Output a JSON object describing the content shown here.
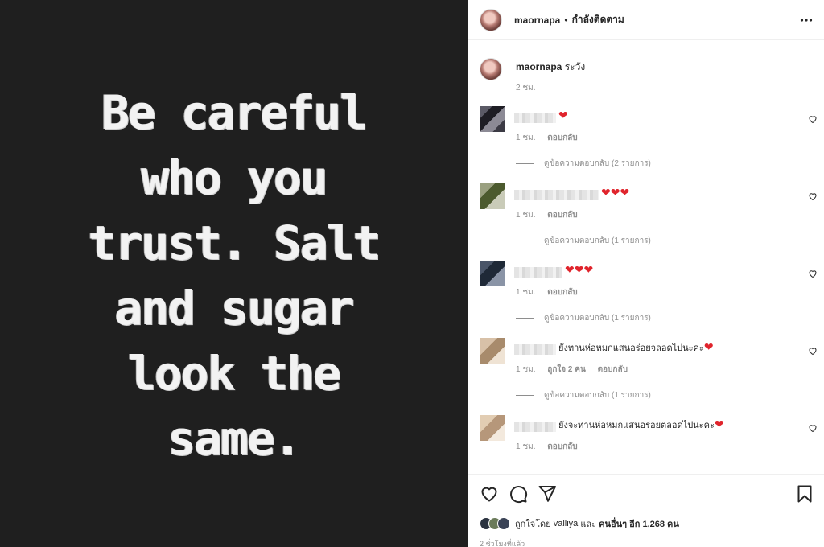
{
  "post": {
    "quote_lines": [
      "Be careful",
      "who you",
      "trust. Salt",
      "and sugar",
      "look the",
      "same."
    ]
  },
  "header": {
    "username": "maornapa",
    "separator": "•",
    "follow_label": "กำลังติดตาม",
    "more_icon": "more-horizontal-icon"
  },
  "caption": {
    "username": "maornapa",
    "text": "ระวัง",
    "time": "2 ชม."
  },
  "comments": [
    {
      "text": "❤",
      "time": "1 ชม.",
      "likes": "",
      "reply": "ตอบกลับ",
      "view_replies": "ดูข้อความตอบกลับ (2 รายการ)"
    },
    {
      "text": "❤❤❤",
      "time": "1 ชม.",
      "likes": "",
      "reply": "ตอบกลับ",
      "view_replies": "ดูข้อความตอบกลับ (1 รายการ)"
    },
    {
      "text": "❤❤❤",
      "time": "1 ชม.",
      "likes": "",
      "reply": "ตอบกลับ",
      "view_replies": "ดูข้อความตอบกลับ (1 รายการ)"
    },
    {
      "text": "ยังทานห่อหมกแสนอร่อยจลอดไปนะคะ❤",
      "time": "1 ชม.",
      "likes": "ถูกใจ 2 คน",
      "reply": "ตอบกลับ",
      "view_replies": "ดูข้อความตอบกลับ (1 รายการ)"
    },
    {
      "text": "ยังจะทานห่อหมกแสนอร่อยตลอดไปนะคะ❤",
      "time": "1 ชม.",
      "likes": "",
      "reply": "ตอบกลับ",
      "view_replies": ""
    }
  ],
  "actions": {
    "like_icon": "heart-icon",
    "comment_icon": "comment-icon",
    "share_icon": "share-icon",
    "save_icon": "bookmark-icon"
  },
  "likes": {
    "prefix": "ถูกใจโดย",
    "user": "valliya",
    "conjunction": "และ",
    "others": "คนอื่นๆ อีก 1,268 คน"
  },
  "posted_time": "2 ชั่วโมงที่แล้ว",
  "colors": {
    "heart": "#e0242c",
    "image_bg": "#1f1f1f",
    "muted": "#8e8e8e"
  }
}
